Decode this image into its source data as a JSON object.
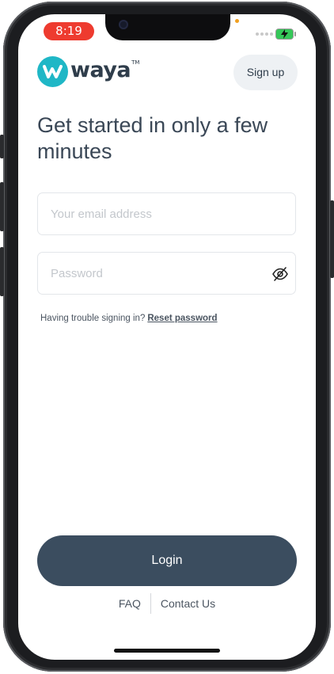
{
  "status_bar": {
    "time": "8:19"
  },
  "header": {
    "logo_text": "waya",
    "logo_tm": "TM",
    "signup_label": "Sign up"
  },
  "main": {
    "headline": "Get started in only a few minutes",
    "email_placeholder": "Your email address",
    "password_placeholder": "Password",
    "trouble_text": "Having trouble signing in?",
    "reset_link": "Reset password",
    "login_label": "Login"
  },
  "footer": {
    "faq_label": "FAQ",
    "contact_label": "Contact Us"
  },
  "colors": {
    "brand_teal": "#1fb7c6",
    "primary_button": "#3b4d5f",
    "status_pill": "#ee3b2f"
  },
  "icons": {
    "password_toggle": "eye-off-icon",
    "battery": "battery-charging-icon"
  }
}
